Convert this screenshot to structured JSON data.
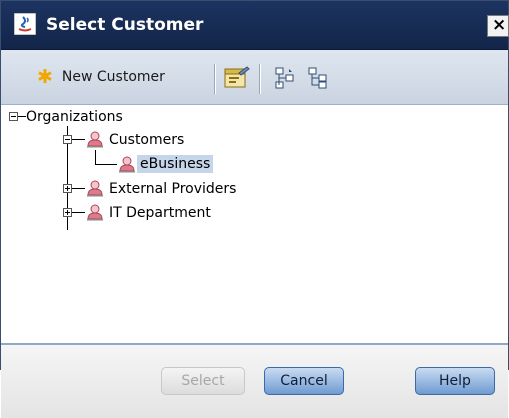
{
  "window": {
    "title": "Select Customer",
    "close_label": "×"
  },
  "toolbar": {
    "new_customer_label": "New Customer"
  },
  "tree": {
    "root": "Organizations",
    "customers": "Customers",
    "ebusiness": "eBusiness",
    "external_providers": "External Providers",
    "it_department": "IT Department"
  },
  "footer": {
    "select_label": "Select",
    "cancel_label": "Cancel",
    "help_label": "Help"
  },
  "colors": {
    "titlebar": "#1c3461",
    "selection": "#c5d6ea",
    "button_accent": "#6f9bd2",
    "org_icon": "#e07a8a"
  }
}
